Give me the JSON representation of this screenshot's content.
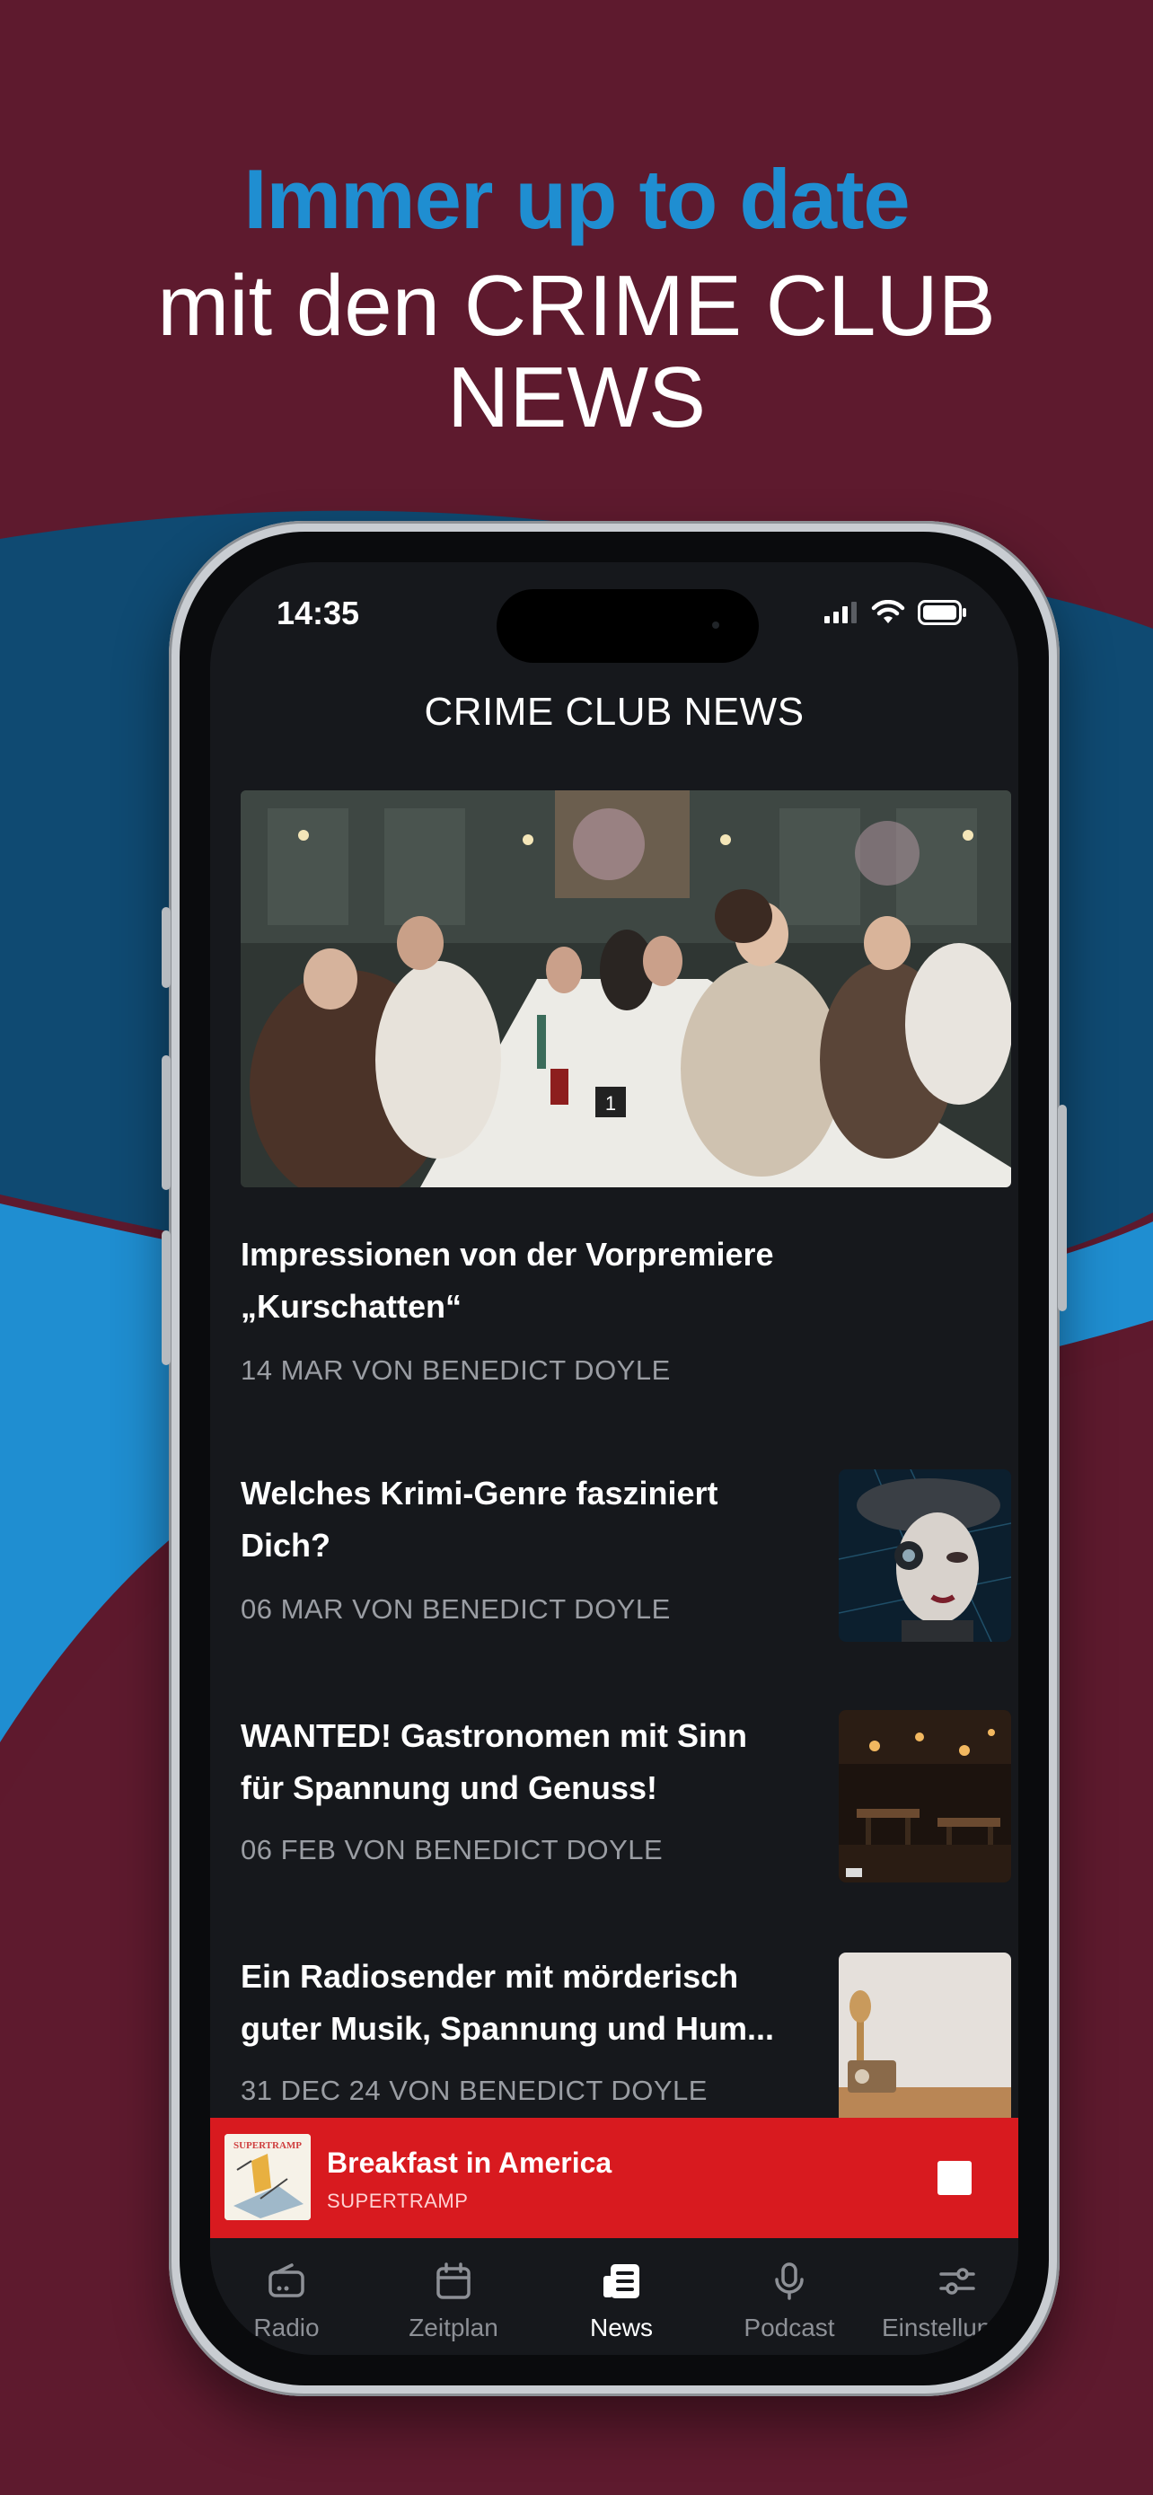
{
  "promo": {
    "headline_accent": "Immer up to date",
    "headline_line2": "mit den CRIME CLUB",
    "headline_line3": "NEWS"
  },
  "status_bar": {
    "time": "14:35"
  },
  "header": {
    "title": "CRIME CLUB NEWS"
  },
  "featured": {
    "title_line1": "Impressionen von der Vorpremiere",
    "title_line2": "„Kurschatten“",
    "meta": "14 MAR VON BENEDICT DOYLE"
  },
  "news_items": [
    {
      "title_line1": "Welches Krimi-Genre fasziniert",
      "title_line2": "Dich?",
      "meta": "06 MAR VON BENEDICT DOYLE"
    },
    {
      "title_line1": "WANTED! Gastronomen mit Sinn",
      "title_line2": "für Spannung und Genuss!",
      "meta": "06 FEB VON BENEDICT DOYLE"
    },
    {
      "title_line1": "Ein Radiosender mit mörderisch",
      "title_line2": "guter Musik, Spannung und Hum...",
      "meta": "31 DEC 24 VON BENEDICT DOYLE"
    }
  ],
  "player": {
    "cover_text": "SUPERTRAMP",
    "title": "Breakfast in America",
    "artist": "SUPERTRAMP",
    "accent_color": "#d81a1f"
  },
  "tabs": [
    {
      "label": "Radio",
      "icon": "radio-icon",
      "active": false
    },
    {
      "label": "Zeitplan",
      "icon": "calendar-icon",
      "active": false
    },
    {
      "label": "News",
      "icon": "newspaper-icon",
      "active": true
    },
    {
      "label": "Podcast",
      "icon": "microphone-icon",
      "active": false
    },
    {
      "label": "Einstellungen",
      "icon": "sliders-icon",
      "active": false
    }
  ],
  "colors": {
    "background": "#5e1a2e",
    "accent_blue": "#1f8ed1",
    "wave_dark": "#0f4a72"
  }
}
